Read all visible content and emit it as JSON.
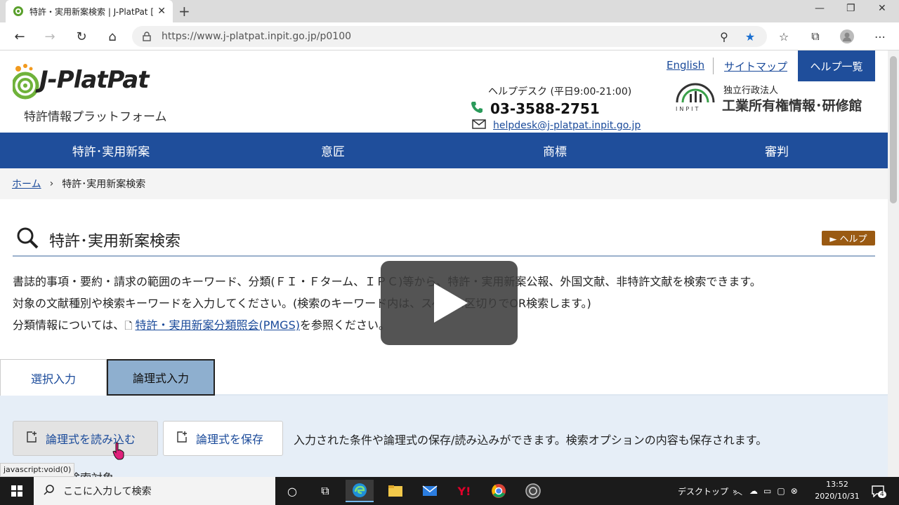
{
  "browser": {
    "tab_title": "特許・実用新案検索 | J-PlatPat [JPP]",
    "url": "https://www.j-platpat.inpit.go.jp/p0100"
  },
  "header": {
    "logo_text": "J-PlatPat",
    "logo_sub": "特許情報プラットフォーム",
    "link_english": "English",
    "link_sitemap": "サイトマップ",
    "help_list": "ヘルプ一覧",
    "helpdesk_label": "ヘルプデスク (平日9:00-21:00)",
    "phone": "03-3588-2751",
    "email": "helpdesk@j-platpat.inpit.go.jp",
    "org_small": "独立行政法人",
    "org_big": "工業所有権情報･研修館"
  },
  "nav": [
    "特許･実用新案",
    "意匠",
    "商標",
    "審判"
  ],
  "breadcrumb": {
    "home": "ホーム",
    "current": "特許･実用新案検索"
  },
  "section": {
    "title": "特許･実用新案検索",
    "help": "► ヘルプ",
    "desc1": "書誌的事項・要約・請求の範囲のキーワード、分類(ＦＩ・Ｆターム、ＩＰＣ)等から、特許・実用新案公報、外国文献、非特許文献を検索できます。",
    "desc2": "対象の文献種別や検索キーワードを入力してください。(検索のキーワード内は、スペース区切りでOR検索します。)",
    "desc3_pre": "分類情報については、",
    "desc3_link": "特許・実用新案分類照会(PMGS)",
    "desc3_post": "を参照ください。"
  },
  "tabs": {
    "select": "選択入力",
    "logic": "論理式入力"
  },
  "panel": {
    "load": "論理式を読み込む",
    "save": "論理式を保存",
    "note": "入力された条件や論理式の保存/読み込みができます。検索オプションの内容も保存されます。",
    "cut_text": "検索対象"
  },
  "statusbar": "javascript:void(0)",
  "taskbar": {
    "search_placeholder": "ここに入力して検索",
    "desktop": "デスクトップ",
    "time": "13:52",
    "date": "2020/10/31",
    "notif_count": "4"
  }
}
